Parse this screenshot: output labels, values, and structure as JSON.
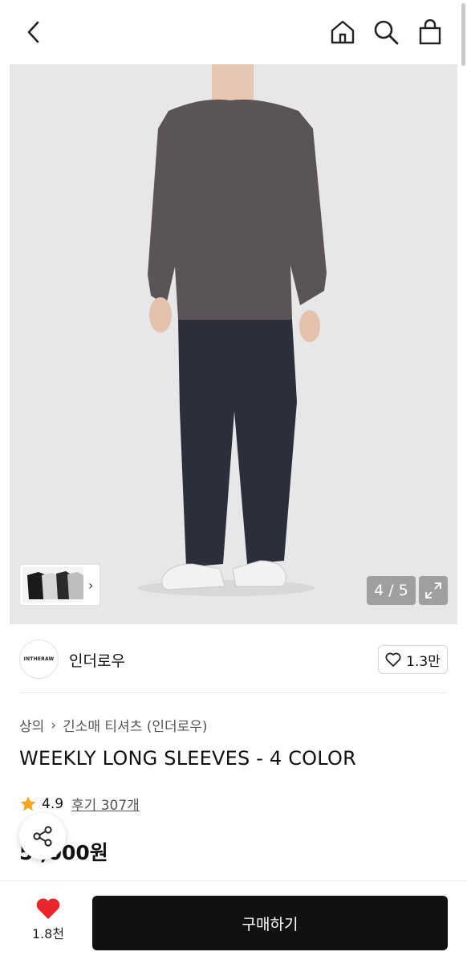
{
  "header": {
    "icons": [
      "back-icon",
      "home-icon",
      "search-icon",
      "cart-icon"
    ]
  },
  "gallery": {
    "counter": "4 / 5",
    "current_index": 4,
    "total": 5
  },
  "brand": {
    "logo_text": "INTHERAW",
    "name": "인더로우",
    "likes": "1.3만"
  },
  "product": {
    "breadcrumb": [
      "상의",
      "긴소매 티셔츠 (인더로우)"
    ],
    "title": "WEEKLY LONG SLEEVES - 4 COLOR",
    "rating": "4.9",
    "reviews": "후기 307개",
    "price": "5 ,000원"
  },
  "bottom": {
    "wish_count": "1.8천",
    "buy_label": "구매하기"
  },
  "colors": {
    "accent_star": "#f5a623",
    "heart": "#e8242c",
    "buy_button": "#111111"
  }
}
